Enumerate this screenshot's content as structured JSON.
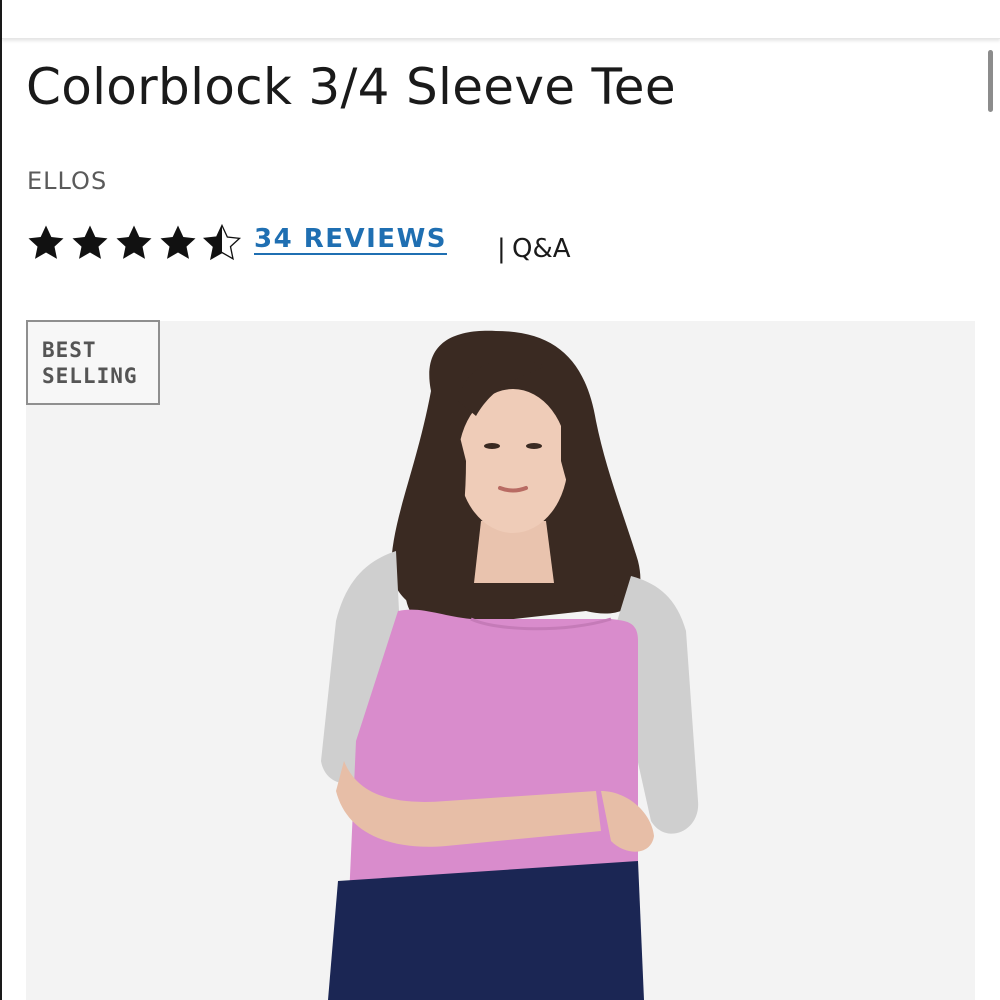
{
  "product": {
    "title": "Colorblock 3/4 Sleeve Tee",
    "brand": "ELLOS"
  },
  "rating": {
    "value": 4.5,
    "max": 5,
    "reviews_label": "34 REVIEWS",
    "separator": "|",
    "qa_label": "Q&A"
  },
  "badge": {
    "line1": "BEST",
    "line2": "SELLING"
  },
  "colors": {
    "link": "#1f6fb2",
    "text": "#1a1a1a",
    "image_background": "#f3f3f3",
    "top_color": "#d98ccc",
    "sleeve_color": "#cfcfcf",
    "pants_color": "#1b2654"
  },
  "icons": {
    "star": "star-filled-icon",
    "half_star": "star-half-icon"
  }
}
